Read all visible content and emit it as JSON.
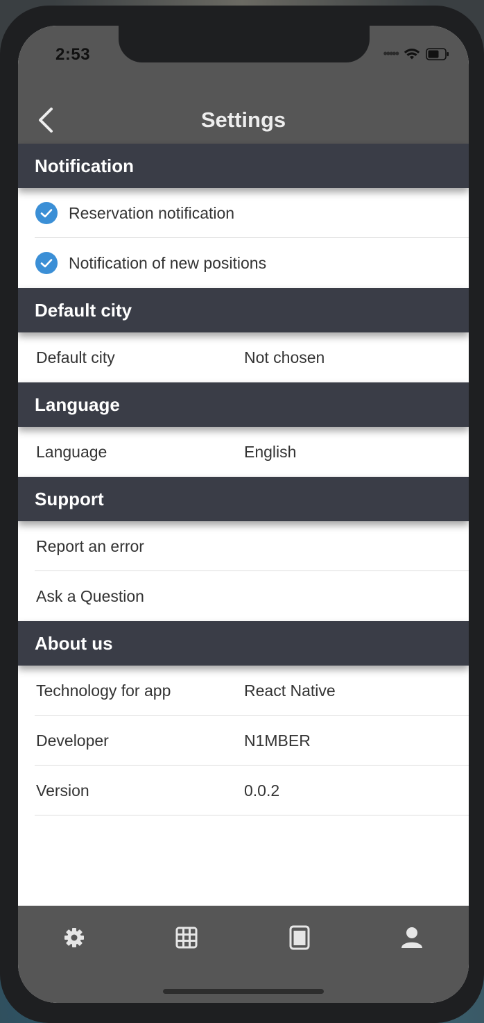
{
  "status_bar": {
    "time": "2:53"
  },
  "header": {
    "title": "Settings"
  },
  "sections": {
    "notification": {
      "title": "Notification",
      "items": [
        {
          "label": "Reservation notification",
          "checked": true
        },
        {
          "label": "Notification of new positions",
          "checked": true
        }
      ]
    },
    "default_city": {
      "title": "Default city",
      "items": [
        {
          "label": "Default city",
          "value": "Not chosen"
        }
      ]
    },
    "language": {
      "title": "Language",
      "items": [
        {
          "label": "Language",
          "value": "English"
        }
      ]
    },
    "support": {
      "title": "Support",
      "items": [
        {
          "label": "Report an error"
        },
        {
          "label": "Ask a Question"
        }
      ]
    },
    "about": {
      "title": "About us",
      "items": [
        {
          "label": "Technology for app",
          "value": "React Native"
        },
        {
          "label": "Developer",
          "value": "N1MBER"
        },
        {
          "label": "Version",
          "value": "0.0.2"
        }
      ]
    }
  },
  "tab_bar": {
    "tabs": [
      {
        "icon": "gear-icon"
      },
      {
        "icon": "grid-icon"
      },
      {
        "icon": "tablet-icon"
      },
      {
        "icon": "user-icon"
      }
    ]
  },
  "colors": {
    "header_bg": "#565656",
    "section_bg": "#3a3d47",
    "check_blue": "#3b8fd6",
    "tab_icon": "#e6e6e6"
  }
}
